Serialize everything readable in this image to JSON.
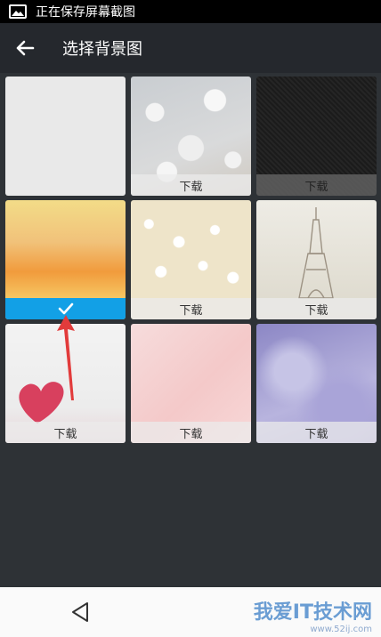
{
  "status_bar": {
    "text": "正在保存屏幕截图",
    "icon": "image-icon"
  },
  "header": {
    "title": "选择背景图",
    "back_icon": "arrow-left-icon"
  },
  "backgrounds": [
    {
      "label": ""
    },
    {
      "label": "下载"
    },
    {
      "label": "下载"
    },
    {
      "label": "",
      "selected": true
    },
    {
      "label": "下载"
    },
    {
      "label": "下载"
    },
    {
      "label": "下载"
    },
    {
      "label": "下载"
    },
    {
      "label": "下载"
    }
  ],
  "watermark": {
    "main": "我爱IT技术网",
    "sub": "www.52ij.com"
  },
  "colors": {
    "accent": "#12a0e6",
    "annotation": "#e23b3b"
  }
}
